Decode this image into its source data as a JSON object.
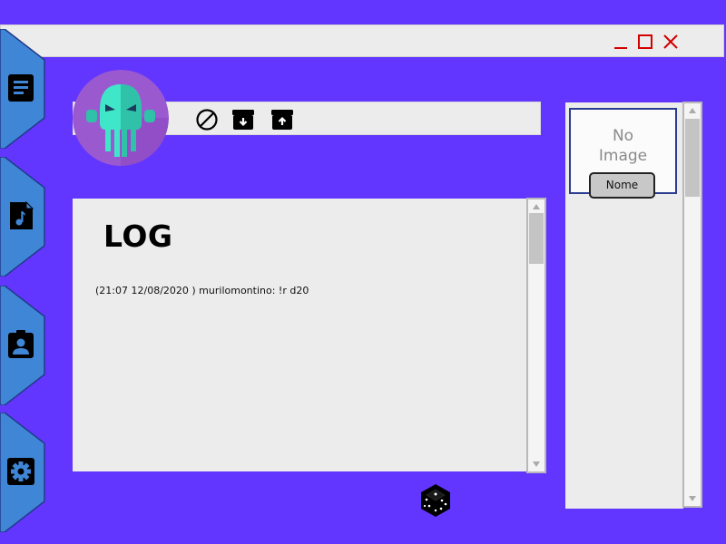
{
  "window": {
    "controls": {
      "minimize_icon": "minimize-icon",
      "maximize_icon": "maximize-icon",
      "close_icon": "close-icon",
      "color": "#d40000"
    }
  },
  "sidebar": {
    "tabs": [
      {
        "id": "notes",
        "icon": "document-icon"
      },
      {
        "id": "music",
        "icon": "music-file-icon"
      },
      {
        "id": "profile",
        "icon": "contact-card-icon"
      },
      {
        "id": "settings",
        "icon": "gear-icon"
      }
    ],
    "tab_color": "#3f86d6"
  },
  "avatar": {
    "icon": "cthulhu-icon"
  },
  "toolbar": {
    "buttons": [
      {
        "id": "block",
        "icon": "block-icon"
      },
      {
        "id": "download",
        "icon": "archive-down-icon"
      },
      {
        "id": "upload",
        "icon": "archive-up-icon"
      }
    ]
  },
  "log": {
    "title": "LOG",
    "entries": [
      {
        "text": "(21:07 12/08/2020 ) murilomontino: !r d20"
      }
    ]
  },
  "right_panel": {
    "card": {
      "placeholder_line1": "No",
      "placeholder_line2": "Image",
      "name_button_label": "Nome"
    }
  },
  "dice": {
    "icon": "dice-icon"
  },
  "colors": {
    "background": "#6236ff",
    "panel": "#ececec",
    "accent_border": "#2b3d8f"
  }
}
